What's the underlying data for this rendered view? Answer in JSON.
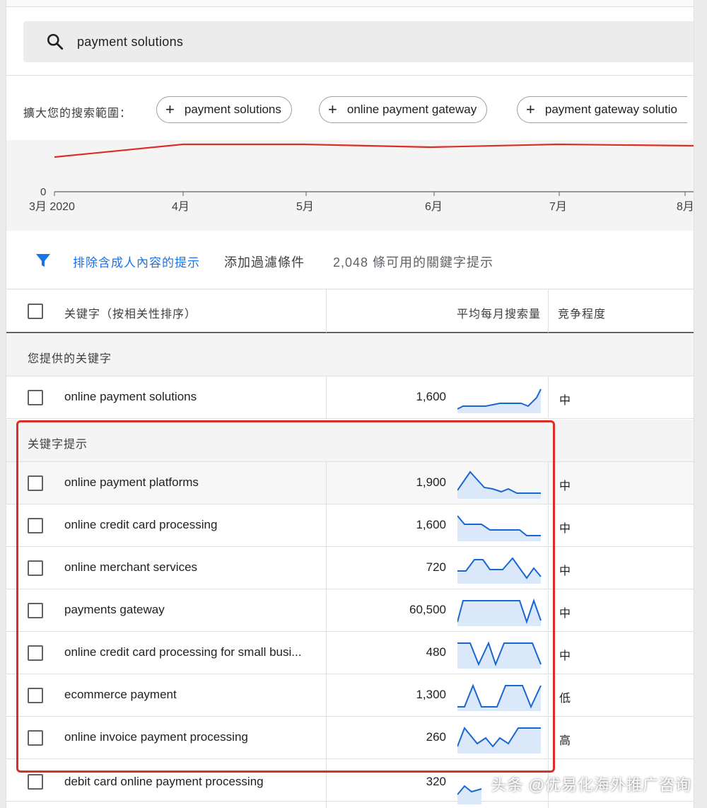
{
  "search": {
    "query": "payment solutions"
  },
  "broaden": {
    "label": "擴大您的搜索範圍：",
    "chips": [
      "payment solutions",
      "online payment gateway",
      "payment gateway solutio"
    ]
  },
  "chart": {
    "y_zero_label": "0",
    "x_labels": [
      "3月 2020",
      "4月",
      "5月",
      "6月",
      "7月",
      "8月"
    ],
    "line_color": "#d93025"
  },
  "filter": {
    "exclude_adult": "排除含成人內容的提示",
    "add_filter": "添加過濾條件",
    "available_count": "2,048 條可用的關鍵字提示"
  },
  "table": {
    "headers": {
      "keyword": "关键字（按相关性排序）",
      "avg_monthly": "平均每月搜索量",
      "competition": "竞争程度"
    },
    "provided_group": "您提供的关键字",
    "ideas_group": "关键字提示",
    "provided_rows": [
      {
        "keyword": "online payment solutions",
        "volume": "1,600",
        "competition": "中"
      }
    ],
    "idea_rows": [
      {
        "keyword": "online payment platforms",
        "volume": "1,900",
        "competition": "中"
      },
      {
        "keyword": "online credit card processing",
        "volume": "1,600",
        "competition": "中"
      },
      {
        "keyword": "online merchant services",
        "volume": "720",
        "competition": "中"
      },
      {
        "keyword": "payments gateway",
        "volume": "60,500",
        "competition": "中"
      },
      {
        "keyword": "online credit card processing for small busi...",
        "volume": "480",
        "competition": "中"
      },
      {
        "keyword": "ecommerce payment",
        "volume": "1,300",
        "competition": "低"
      },
      {
        "keyword": "online invoice payment processing",
        "volume": "260",
        "competition": "高"
      },
      {
        "keyword": "debit card online payment processing",
        "volume": "320",
        "competition": ""
      }
    ]
  },
  "watermark": "头条 @优易化海外推广咨询",
  "colors": {
    "accent": "#1a73e8",
    "highlight": "#d93025",
    "spark": "#1967d2"
  }
}
